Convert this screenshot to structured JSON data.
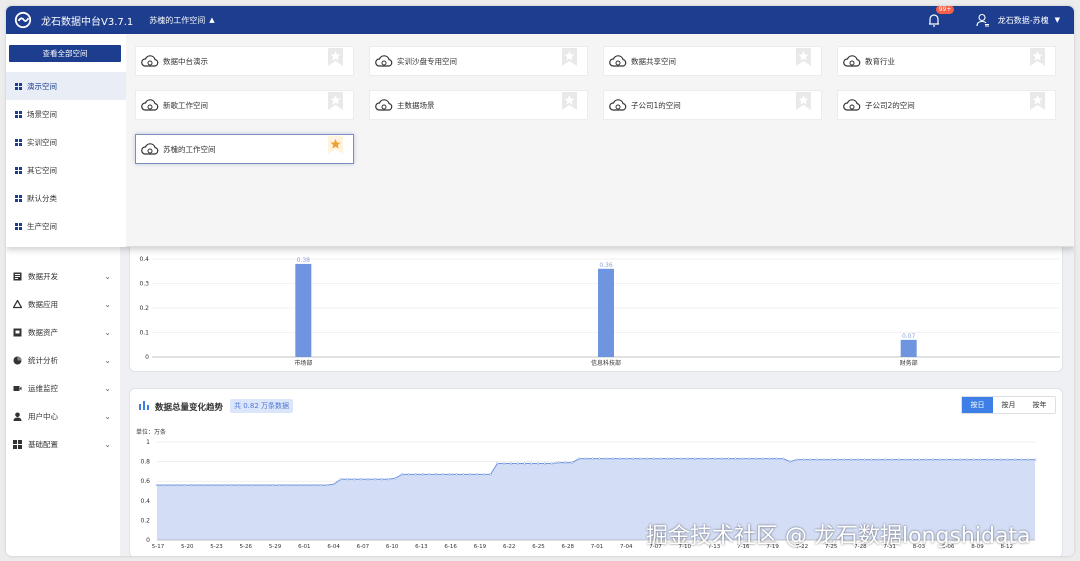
{
  "header": {
    "app_title": "龙石数据中台V3.7.1",
    "workspace": "苏槐的工作空间",
    "notification_badge": "99+",
    "user_name": "龙石数据-苏槐"
  },
  "sidebar": {
    "items": [
      {
        "label": "数据开发",
        "icon": "code-icon"
      },
      {
        "label": "数据应用",
        "icon": "recycle-icon"
      },
      {
        "label": "数据资产",
        "icon": "asset-icon"
      },
      {
        "label": "统计分析",
        "icon": "pie-icon"
      },
      {
        "label": "运维监控",
        "icon": "video-icon"
      },
      {
        "label": "用户中心",
        "icon": "user-icon"
      },
      {
        "label": "基础配置",
        "icon": "grid-icon"
      }
    ]
  },
  "panel": {
    "view_all": "查看全部空间",
    "categories": [
      {
        "label": "演示空间",
        "active": true
      },
      {
        "label": "场景空间",
        "active": false
      },
      {
        "label": "实训空间",
        "active": false
      },
      {
        "label": "其它空间",
        "active": false
      },
      {
        "label": "默认分类",
        "active": false
      },
      {
        "label": "生产空间",
        "active": false
      }
    ],
    "spaces": [
      {
        "label": "数据中台演示",
        "starred": false,
        "selected": false
      },
      {
        "label": "实训沙盘专用空间",
        "starred": false,
        "selected": false
      },
      {
        "label": "数据共享空间",
        "starred": false,
        "selected": false
      },
      {
        "label": "教育行业",
        "starred": false,
        "selected": false
      },
      {
        "label": "新歌工作空间",
        "starred": false,
        "selected": false
      },
      {
        "label": "主数据场景",
        "starred": false,
        "selected": false
      },
      {
        "label": "子公司1的空间",
        "starred": false,
        "selected": false
      },
      {
        "label": "子公司2的空间",
        "starred": false,
        "selected": false
      },
      {
        "label": "苏槐的工作空间",
        "starred": true,
        "selected": true
      }
    ]
  },
  "trend": {
    "title": "数据总量变化趋势",
    "total_badge": "共 0.82 万条数据",
    "tabs": [
      "按日",
      "按月",
      "按年"
    ],
    "active_tab": "按日",
    "unit_label": "单位：万条"
  },
  "colors": {
    "header": "#1d3d8f",
    "bar": "#6f95e0",
    "line": "#6f95e0",
    "area": "#d3ddf5",
    "star_active": "#f0a030"
  },
  "watermark": "掘金技术社区 @ 龙石数据longshidata",
  "chart_data": [
    {
      "type": "bar",
      "categories": [
        "市场部",
        "信息科技部",
        "财务部"
      ],
      "values": [
        0.38,
        0.36,
        0.07
      ],
      "data_labels": [
        "0.38",
        "0.36",
        "0.07"
      ],
      "yticks": [
        "0",
        "0.1",
        "0.2",
        "0.3",
        "0.4"
      ],
      "ylim": [
        0,
        0.4
      ]
    },
    {
      "type": "area",
      "title": "数据总量变化趋势",
      "ylabel": "单位：万条",
      "ylim": [
        0,
        1
      ],
      "yticks": [
        "0",
        "0.2",
        "0.4",
        "0.6",
        "0.8",
        "1"
      ],
      "xticks": [
        "5-17",
        "5-20",
        "5-23",
        "5-26",
        "5-29",
        "6-01",
        "6-04",
        "6-07",
        "6-10",
        "6-13",
        "6-16",
        "6-19",
        "6-22",
        "6-25",
        "6-28",
        "7-01",
        "7-04",
        "7-07",
        "7-10",
        "7-13",
        "7-16",
        "7-19",
        "7-22",
        "7-25",
        "7-28",
        "7-31",
        "8-03",
        "8-06",
        "8-09",
        "8-12"
      ],
      "values": [
        0.56,
        0.56,
        0.56,
        0.56,
        0.56,
        0.56,
        0.56,
        0.56,
        0.56,
        0.56,
        0.56,
        0.56,
        0.56,
        0.56,
        0.56,
        0.56,
        0.56,
        0.56,
        0.56,
        0.56,
        0.56,
        0.56,
        0.56,
        0.56,
        0.56,
        0.56,
        0.57,
        0.62,
        0.62,
        0.62,
        0.62,
        0.62,
        0.62,
        0.62,
        0.62,
        0.63,
        0.67,
        0.67,
        0.67,
        0.67,
        0.67,
        0.67,
        0.67,
        0.67,
        0.67,
        0.67,
        0.67,
        0.67,
        0.67,
        0.67,
        0.78,
        0.78,
        0.78,
        0.78,
        0.78,
        0.78,
        0.78,
        0.78,
        0.78,
        0.79,
        0.79,
        0.79,
        0.83,
        0.83,
        0.83,
        0.83,
        0.83,
        0.83,
        0.83,
        0.83,
        0.83,
        0.83,
        0.83,
        0.83,
        0.83,
        0.83,
        0.83,
        0.83,
        0.83,
        0.83,
        0.83,
        0.83,
        0.83,
        0.83,
        0.83,
        0.83,
        0.83,
        0.83,
        0.83,
        0.83,
        0.83,
        0.83,
        0.83,
        0.8,
        0.82,
        0.82,
        0.82,
        0.82,
        0.82,
        0.82,
        0.82,
        0.82,
        0.82,
        0.82,
        0.82,
        0.82,
        0.82,
        0.82,
        0.82,
        0.82,
        0.82,
        0.82,
        0.82,
        0.82,
        0.82,
        0.82,
        0.82,
        0.82,
        0.82,
        0.82,
        0.82,
        0.82,
        0.82,
        0.82,
        0.82,
        0.82,
        0.82,
        0.82,
        0.82,
        0.82
      ]
    }
  ]
}
